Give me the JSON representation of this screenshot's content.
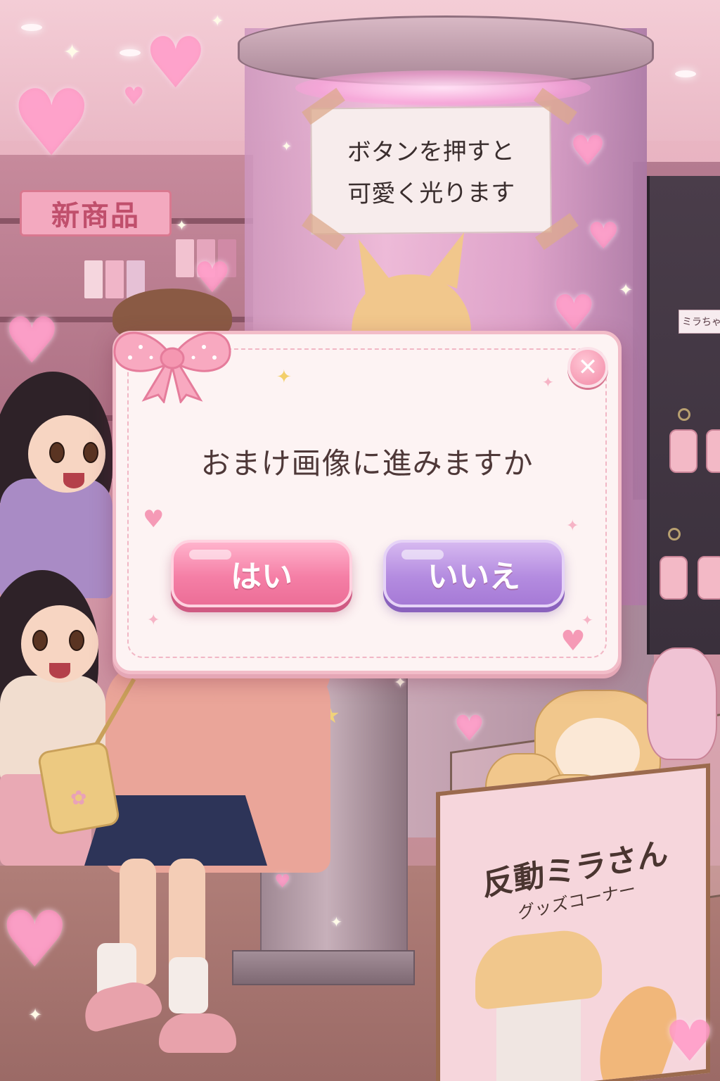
{
  "scene": {
    "banner_text": "新商品",
    "machine_sign": {
      "line1": "ボタンを押すと",
      "line2": "可愛く光ります"
    },
    "peg_label": "ミラちゃん",
    "poster": {
      "title": "反動ミラさん",
      "subtitle": "グッズコーナー"
    }
  },
  "dialog": {
    "question": "おまけ画像に進みますか",
    "yes_label": "はい",
    "no_label": "いいえ",
    "close_symbol": "✕"
  },
  "colors": {
    "dialog_bg": "#fdf3f3",
    "dialog_border": "#f2bcc8",
    "yes_button": "#f57fa6",
    "no_button": "#b48ce0",
    "close_button": "#f28aa6",
    "question_text": "#4e3838"
  },
  "icons": {
    "bow": "pink-bow-icon",
    "close": "close-icon",
    "hearts": "heart-icon",
    "sparkles": "sparkle-icon"
  }
}
